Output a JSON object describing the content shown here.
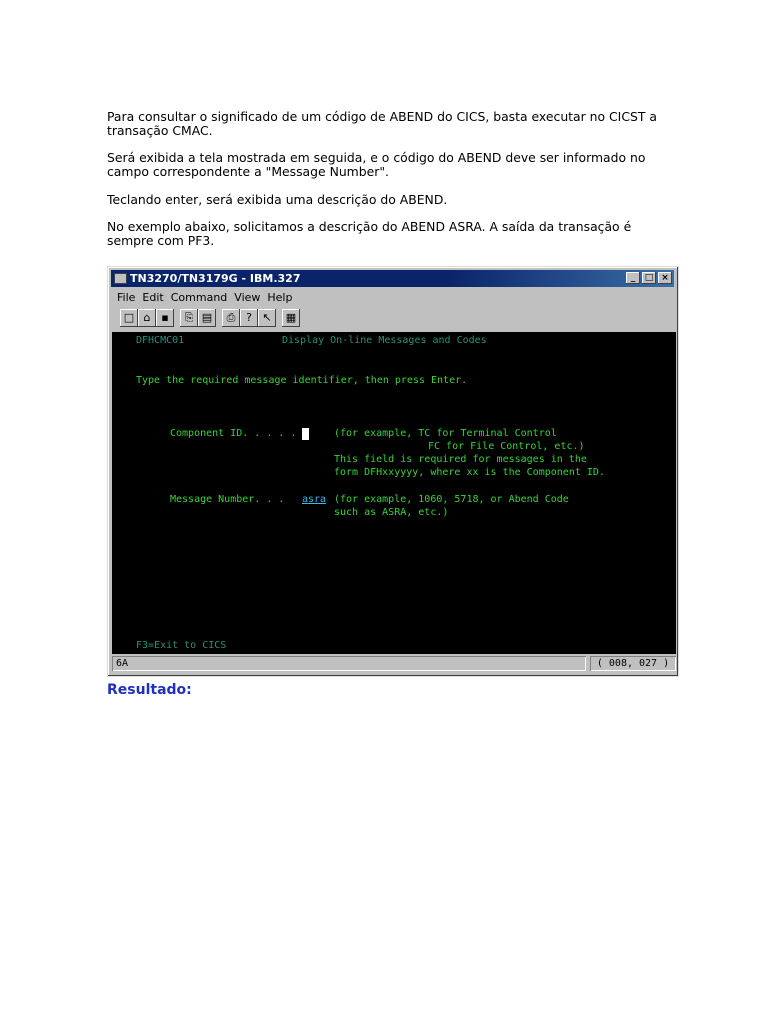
{
  "doc": {
    "p1": "Para consultar o significado de um código de ABEND do CICS, basta executar no CICST a transação CMAC.",
    "p2": "Será exibida a tela mostrada em seguida, e o código do ABEND deve ser informado no campo correspondente a \"Message Number\".",
    "p3": "Teclando enter, será exibida uma descrição do ABEND.",
    "p4": "No exemplo abaixo, solicitamos a descrição do ABEND ASRA. A saída da transação é sempre com PF3.",
    "result": "Resultado:"
  },
  "window": {
    "title": "TN3270/TN3179G  - IBM.327",
    "menu": [
      "File",
      "Edit",
      "Command",
      "View",
      "Help"
    ],
    "toolbar_icons": [
      "new-icon",
      "open-icon",
      "save-icon",
      "copy-icon",
      "paste-icon",
      "print-icon",
      "help-icon",
      "context-help-icon",
      "settings-icon"
    ],
    "controls": {
      "minimize": "_",
      "maximize": "□",
      "close": "×"
    }
  },
  "screen": {
    "transaction_id": "DFHCMC01",
    "screen_title": "Display On-line Messages and Codes",
    "instruction": "Type the required message identifier, then press Enter.",
    "component_label": "Component ID. . . . .",
    "component_value": "",
    "component_help_1": "(for example, TC for Terminal Control",
    "component_help_2": "FC for File Control, etc.)",
    "component_help_3": "This field is required for messages in the",
    "component_help_4": "form DFHxxyyyy, where xx is the Component ID.",
    "message_label": "Message Number. . .",
    "message_value": "asra",
    "message_help_1": "(for example, 1060, 5718, or Abend Code",
    "message_help_2": "such as ASRA, etc.)",
    "pf_keys": "F3=Exit to CICS"
  },
  "status": {
    "left": "6A",
    "cursor_position": "( 008, 027 )"
  },
  "colors": {
    "screen_text": "#3ad23a",
    "screen_background": "#000000",
    "title_bar": "#0a246a",
    "result_heading": "#1f2fbf"
  }
}
